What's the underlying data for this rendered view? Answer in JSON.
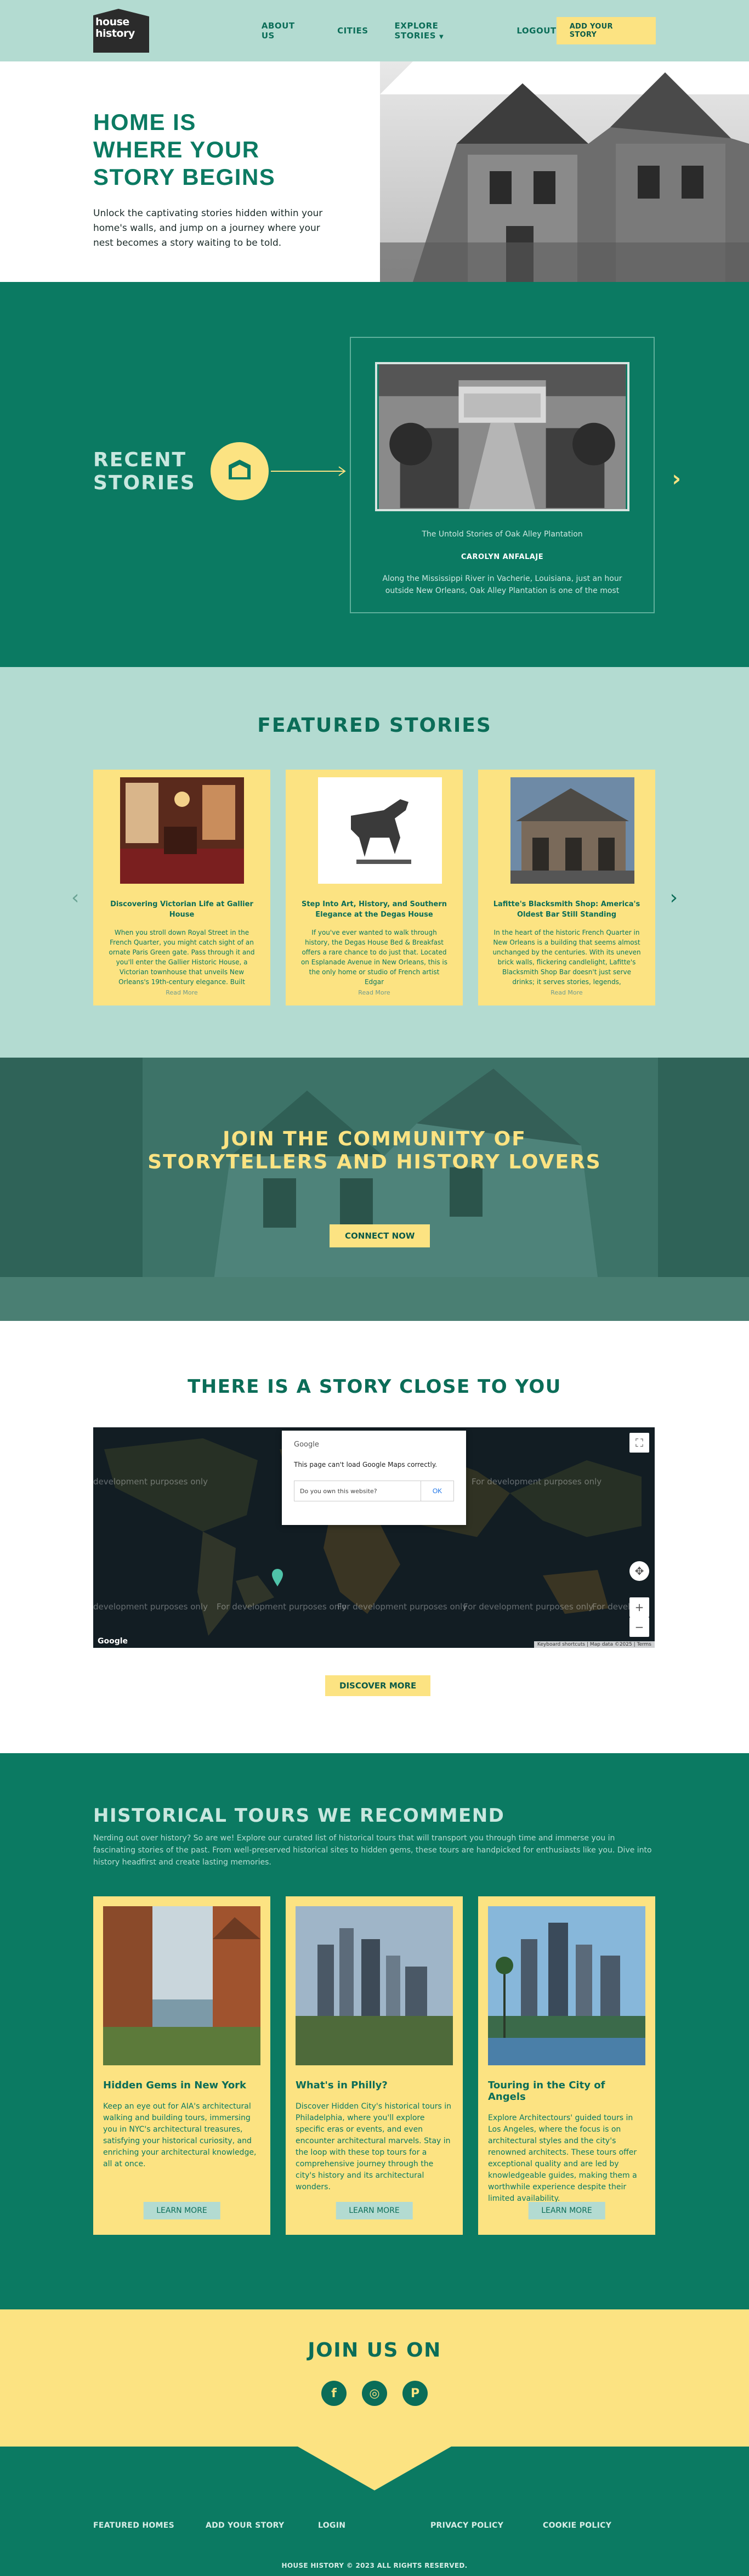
{
  "brand": {
    "logo_text_line1": "house",
    "logo_text_line2": "history"
  },
  "nav": {
    "items": [
      "ABOUT US",
      "CITIES",
      "EXPLORE STORIES",
      "LOGOUT"
    ],
    "cta": "ADD YOUR STORY",
    "colors": {
      "nav_bg": "#b3dbd1",
      "accent": "#fce382",
      "primary": "#0b7a62"
    }
  },
  "hero": {
    "title_line1": "HOME IS",
    "title_line2": "WHERE YOUR",
    "title_line3": "STORY BEGINS",
    "subtitle": "Unlock the captivating stories hidden within your home's walls, and jump on a journey where your nest becomes a story waiting to be told."
  },
  "recent": {
    "title_line1": "RECENT",
    "title_line2": "STORIES",
    "card_title": "The Untold Stories of Oak Alley Plantation",
    "card_author": "CAROLYN ANFALAJE",
    "card_text": "Along the Mississippi River in Vacherie, Louisiana, just an hour outside New Orleans, Oak Alley Plantation is one of the most"
  },
  "featured": {
    "title": "FEATURED STORIES",
    "cards": [
      {
        "title": "Discovering Victorian Life at Gallier House",
        "text": "When you stroll down Royal Street in the French Quarter, you might catch sight of an ornate Paris Green gate. Pass through it and you'll enter the Gallier Historic House, a Victorian townhouse that unveils New Orleans's 19th-century elegance. Built",
        "more": "Read More"
      },
      {
        "title": "Step Into Art, History, and Southern Elegance at the Degas House",
        "text": "If you've ever wanted to walk through history, the Degas House Bed & Breakfast offers a rare chance to do just that. Located on Esplanade Avenue in New Orleans, this is the only home or studio of French artist Edgar",
        "more": "Read More"
      },
      {
        "title": "Lafitte's Blacksmith Shop: America's Oldest Bar Still Standing",
        "text": "In the heart of the historic French Quarter in New Orleans is a building that seems almost unchanged by the centuries. With its uneven brick walls, flickering candlelight, Lafitte's Blacksmith Shop Bar doesn't just serve drinks; it serves stories, legends,",
        "more": "Read More"
      }
    ]
  },
  "community": {
    "title_line1": "JOIN THE COMMUNITY OF",
    "title_line2": "STORYTELLERS AND HISTORY LOVERS",
    "button": "CONNECT NOW"
  },
  "story_close": {
    "title": "THERE IS A STORY CLOSE TO YOU",
    "map": {
      "dialog_brand": "Google",
      "dialog_message": "This page can't load Google Maps correctly.",
      "dialog_question": "Do you own this website?",
      "dialog_ok": "OK",
      "watermark": "For development purposes only",
      "watermark_cut": "development purposes only",
      "watermark_tail": "For develo",
      "google_label": "Google",
      "attribution": "Keyboard shortcuts | Map data ©2025 | Terms"
    },
    "button": "DISCOVER MORE"
  },
  "tours": {
    "title": "HISTORICAL TOURS WE RECOMMEND",
    "subtitle": "Nerding out over history? So are we! Explore our curated list of historical tours that will transport you through time and immerse you in fascinating stories of the past. From well-preserved historical sites to hidden gems, these tours are handpicked for enthusiasts like you. Dive into history headfirst and create lasting memories.",
    "cards": [
      {
        "title": "Hidden Gems in New York",
        "text": "Keep an eye out for AIA's architectural walking and building tours, immersing you in NYC's architectural treasures, satisfying your historical curiosity, and enriching your architectural knowledge, all at once.",
        "button": "LEARN MORE"
      },
      {
        "title": "What's in Philly?",
        "text": "Discover Hidden City's historical tours in Philadelphia, where you'll explore specific eras or events, and even encounter architectural marvels. Stay in the loop with these top tours for a comprehensive journey through the city's history and its architectural wonders.",
        "button": "LEARN MORE"
      },
      {
        "title": "Touring in the City of Angels",
        "text": "Explore Architectours' guided tours in Los Angeles, where the focus is on architectural styles and the city's renowned architects. These tours offer exceptional quality and are led by knowledgeable guides, making them a worthwhile experience despite their limited availability.",
        "button": "LEARN MORE"
      }
    ]
  },
  "join": {
    "title": "JOIN US ON",
    "socials": [
      {
        "name": "facebook-icon",
        "glyph": "f"
      },
      {
        "name": "instagram-icon",
        "glyph": "◎"
      },
      {
        "name": "pinterest-icon",
        "glyph": "P"
      }
    ]
  },
  "footer": {
    "links": [
      "FEATURED HOMES",
      "ADD YOUR STORY",
      "LOGIN",
      "PRIVACY POLICY",
      "COOKIE POLICY"
    ],
    "copyright": "HOUSE HISTORY © 2023 ALL RIGHTS RESERVED."
  }
}
